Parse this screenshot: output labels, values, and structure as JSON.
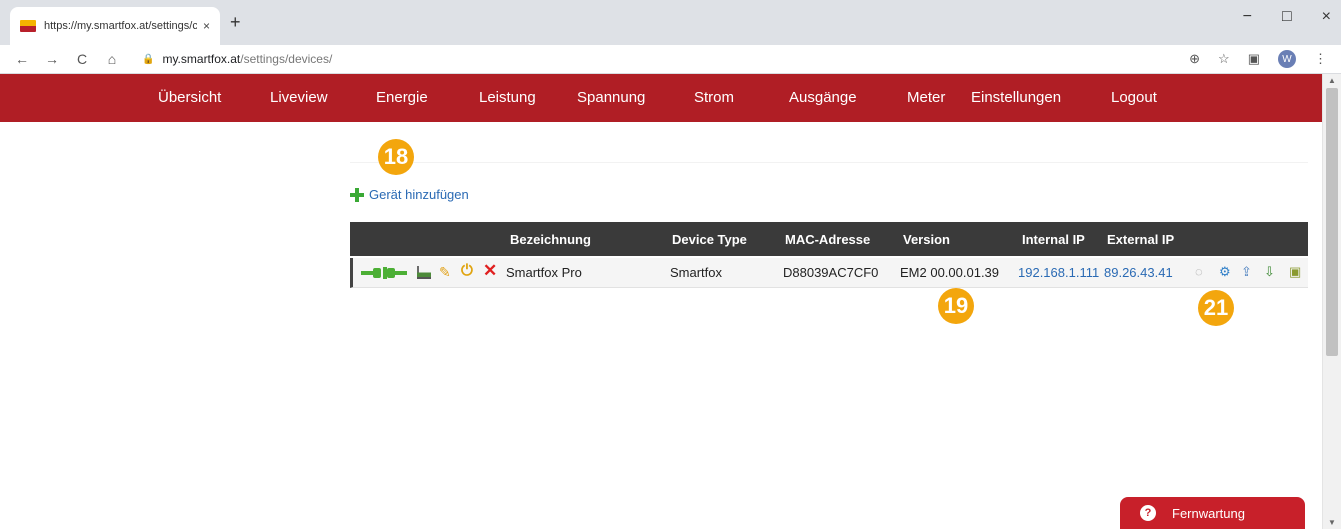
{
  "browser": {
    "tab_title": "https://my.smartfox.at/settings/c",
    "tab_close": "×",
    "new_tab": "+",
    "url_host": "my.smartfox.at",
    "url_path": "/settings/devices/",
    "controls": {
      "minimize": "−",
      "maximize": "□",
      "close": "×"
    },
    "nav": {
      "back": "←",
      "forward": "→",
      "reload": "C",
      "home": "⌂"
    },
    "lock": "🔒",
    "profile": "W",
    "right_icons": {
      "zoom": "⊕",
      "star": "☆",
      "cast": "▣",
      "menu": "⋮"
    }
  },
  "nav": {
    "items": [
      "Übersicht",
      "Liveview",
      "Energie",
      "Leistung",
      "Spannung",
      "Strom",
      "Ausgänge",
      "Meter",
      "Einstellungen",
      "Logout"
    ]
  },
  "badges": {
    "b18": "18",
    "b19": "19",
    "b21": "21"
  },
  "actions": {
    "add_device": "Gerät hinzufügen"
  },
  "table": {
    "headers": [
      "Bezeichnung",
      "Device Type",
      "MAC-Adresse",
      "Version",
      "Internal IP",
      "External IP"
    ],
    "rows": [
      {
        "name": "Smartfox Pro",
        "device_type": "Smartfox",
        "mac": "D88039AC7CF0",
        "version": "EM2 00.00.01.39",
        "internal_ip": "192.168.1.111",
        "external_ip": "89.26.43.41"
      }
    ]
  },
  "row_icons": {
    "pencil": "✎",
    "power": "⏻",
    "delete": "✕",
    "refresh": "◌",
    "gear": "⚙",
    "upload": "⇪",
    "download": "⇩",
    "package": "▣"
  },
  "remote": {
    "label": "Fernwartung",
    "icon": "?"
  },
  "scrollbar": {
    "up": "▲",
    "down": "▼"
  },
  "colors": {
    "nav_bg": "#b01e25",
    "accent_badge": "#f3a60d",
    "link": "#2a6ab4",
    "header_bg": "#3a3a3a"
  }
}
